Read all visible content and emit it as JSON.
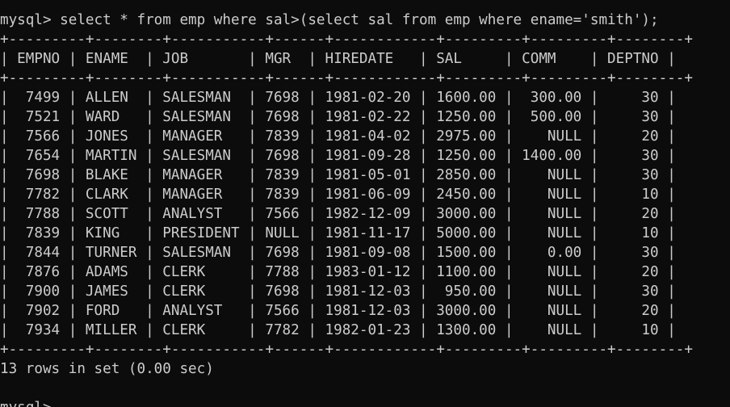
{
  "terminal": {
    "command_line": "mysql> select * from emp where sal>(select sal from emp where ename='smith');",
    "table": {
      "border": "+---------+--------+-----------+------+------------+---------+---------+--------+",
      "header": "| EMPNO | ENAME  | JOB       | MGR  | HIREDATE   | SAL     | COMM    | DEPTNO |",
      "rows": [
        "|  7499 | ALLEN  | SALESMAN  | 7698 | 1981-02-20 | 1600.00 |  300.00 |     30 |",
        "|  7521 | WARD   | SALESMAN  | 7698 | 1981-02-22 | 1250.00 |  500.00 |     30 |",
        "|  7566 | JONES  | MANAGER   | 7839 | 1981-04-02 | 2975.00 |    NULL |     20 |",
        "|  7654 | MARTIN | SALESMAN  | 7698 | 1981-09-28 | 1250.00 | 1400.00 |     30 |",
        "|  7698 | BLAKE  | MANAGER   | 7839 | 1981-05-01 | 2850.00 |    NULL |     30 |",
        "|  7782 | CLARK  | MANAGER   | 7839 | 1981-06-09 | 2450.00 |    NULL |     10 |",
        "|  7788 | SCOTT  | ANALYST   | 7566 | 1982-12-09 | 3000.00 |    NULL |     20 |",
        "|  7839 | KING   | PRESIDENT | NULL | 1981-11-17 | 5000.00 |    NULL |     10 |",
        "|  7844 | TURNER | SALESMAN  | 7698 | 1981-09-08 | 1500.00 |    0.00 |     30 |",
        "|  7876 | ADAMS  | CLERK     | 7788 | 1983-01-12 | 1100.00 |    NULL |     20 |",
        "|  7900 | JAMES  | CLERK     | 7698 | 1981-12-03 |  950.00 |    NULL |     30 |",
        "|  7902 | FORD   | ANALYST   | 7566 | 1981-12-03 | 3000.00 |    NULL |     20 |",
        "|  7934 | MILLER | CLERK     | 7782 | 1982-01-23 | 1300.00 |    NULL |     10 |"
      ]
    },
    "result_summary": "13 rows in set (0.00 sec)",
    "next_prompt": "mysql>"
  }
}
